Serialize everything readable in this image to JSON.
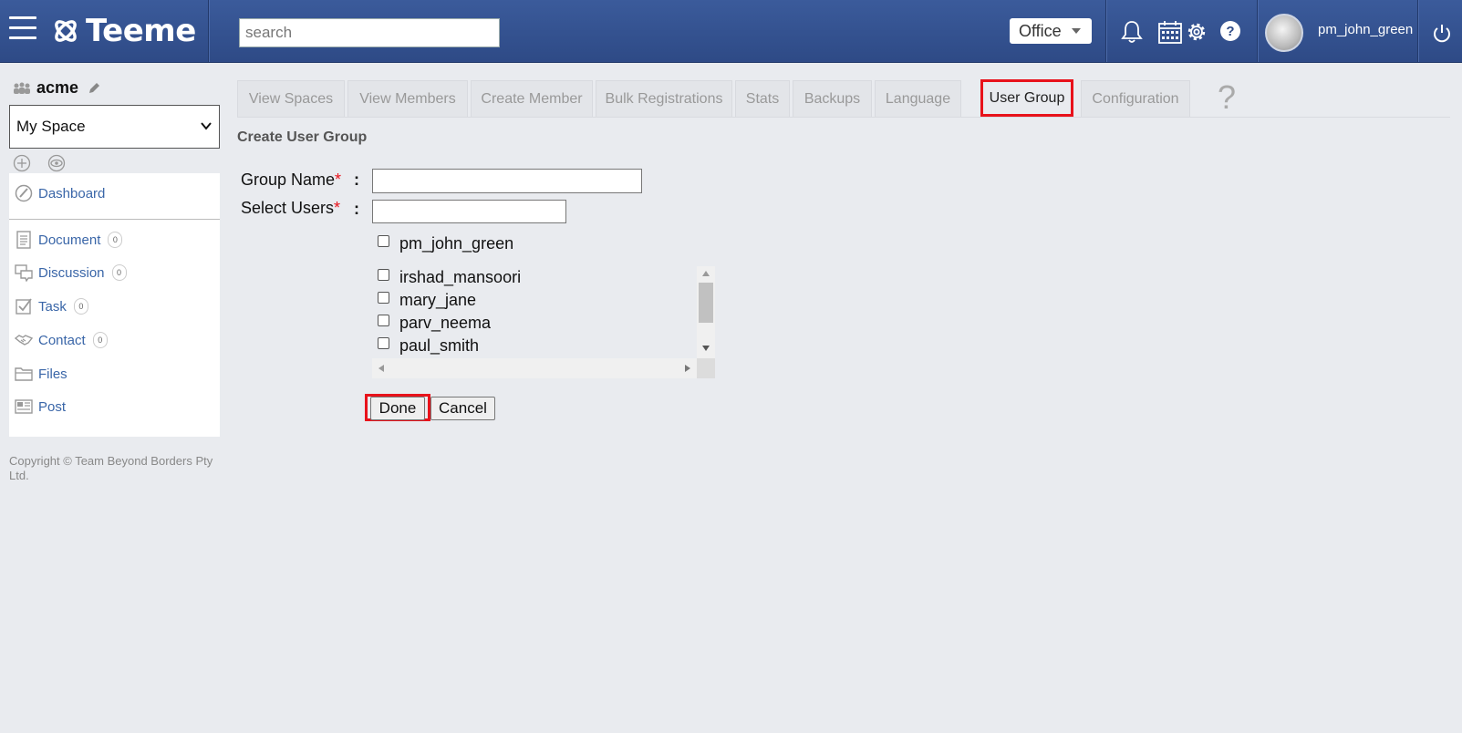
{
  "header": {
    "brand": "Teeme",
    "search_placeholder": "search",
    "office_label": "Office",
    "username": "pm_john_green"
  },
  "sidebar": {
    "space_name": "acme",
    "space_select_value": "My Space",
    "dashboard_label": "Dashboard",
    "items": [
      {
        "label": "Document",
        "count": "0"
      },
      {
        "label": "Discussion",
        "count": "0"
      },
      {
        "label": "Task",
        "count": "0"
      },
      {
        "label": "Contact",
        "count": "0"
      },
      {
        "label": "Files"
      },
      {
        "label": "Post"
      }
    ],
    "copyright": "Copyright © Team Beyond Borders Pty Ltd."
  },
  "tabs": [
    {
      "label": "View Spaces"
    },
    {
      "label": "View Members"
    },
    {
      "label": "Create Member"
    },
    {
      "label": "Bulk Registrations"
    },
    {
      "label": "Stats"
    },
    {
      "label": "Backups"
    },
    {
      "label": "Language"
    },
    {
      "label": "User Group",
      "active": true
    },
    {
      "label": "Configuration"
    }
  ],
  "help_label": "?",
  "form": {
    "title": "Create User Group",
    "group_name_label": "Group Name",
    "select_users_label": "Select Users",
    "required_mark": "*",
    "colon": ":",
    "group_name_value": "",
    "select_users_value": "",
    "self_user": "pm_john_green",
    "users": [
      "irshad_mansoori",
      "mary_jane",
      "parv_neema",
      "paul_smith"
    ],
    "done_label": "Done",
    "cancel_label": "Cancel"
  },
  "colors": {
    "header_bg": "#2e4a86",
    "link": "#3a66a8",
    "highlight": "#e8121b"
  }
}
